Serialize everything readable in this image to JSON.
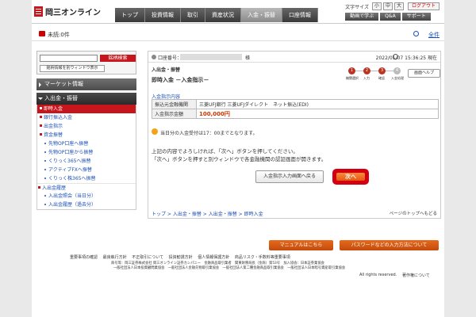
{
  "header": {
    "logo_text": "岡三オンライン",
    "nav": [
      "トップ",
      "投資情報",
      "取引",
      "資産状況",
      "入金・振替",
      "口座情報"
    ],
    "text_size_label": "文字サイズ",
    "text_sizes": [
      "小",
      "中",
      "大"
    ],
    "logout": "ログアウト",
    "util_buttons": [
      "動画で学ぶ",
      "Q&A",
      "サポート"
    ]
  },
  "unread": {
    "text": "未読:0件",
    "all": "全件"
  },
  "sidebar": {
    "search_button": "銘柄検索",
    "search_button2": "銘柄情報を別ウィンドウ表示",
    "market_info": "マーケット情報",
    "section": "入出金・振替",
    "items": [
      {
        "label": "即時入金",
        "kind": "sel"
      },
      {
        "label": "銀行振込入金",
        "kind": "item"
      },
      {
        "label": "出金指示",
        "kind": "item"
      },
      {
        "label": "資金振替",
        "kind": "item"
      },
      {
        "label": "先物OP口座へ振替",
        "kind": "sub"
      },
      {
        "label": "先物OP口座から振替",
        "kind": "sub"
      },
      {
        "label": "くりっく365へ振替",
        "kind": "sub"
      },
      {
        "label": "アクティブFXへ振替",
        "kind": "sub"
      },
      {
        "label": "くりっく株365へ振替",
        "kind": "sub"
      },
      {
        "label": "入出金履歴",
        "kind": "cat"
      },
      {
        "label": "入出金照会（当日分）",
        "kind": "sub"
      },
      {
        "label": "入出金履歴（過去分）",
        "kind": "sub"
      }
    ]
  },
  "main": {
    "account_label": "口座番号：",
    "account_suffix": "様",
    "datetime": "2022/01/07 15:36:25 現在",
    "crumb": "入出金・振替",
    "title": "即時入金 －入金指示－",
    "steps": [
      "1",
      "2",
      "3",
      "4"
    ],
    "step_labels": [
      "機関選択",
      "入力",
      "確認",
      "入金処理"
    ],
    "help": "画面ヘルプ",
    "section": "入金指示内容",
    "rows": [
      {
        "label": "振込元金融機関",
        "value": "三菱UFJ銀行 三菱UFJダイレクト　ネット振込(EDI)"
      },
      {
        "label": "入金指示金額",
        "value": "100,000円"
      }
    ],
    "note": "当日分の入金受付は17：00までとなります。",
    "msg1": "上記の内容でよろしければ、「次へ」ボタンを押してください。",
    "msg2": "「次へ」ボタンを押すと別ウィンドウで各金融機関の認証画面が開きます。",
    "back": "入金指示入力画面へ戻る",
    "next": "次へ",
    "breadcrumb": [
      "トップ",
      "入出金・振替",
      "入出金・振替",
      "即時入金"
    ],
    "page_top": "ページのトップへもどる"
  },
  "footer": {
    "manual": "マニュアルはこちら",
    "password": "パスワードなどの入力方法について",
    "links": [
      "重要事項の確認",
      "最良執行方針",
      "不正取引について",
      "投資勧誘方針",
      "個人情報保護方針",
      "商品リスク・手数料等重要事項"
    ],
    "legal1": "商号等：岡三証券株式会社 岡三オンライン証券カンパニー　金融商品取引業者　関東財務局長（金商）第53号　加入協会：日本証券業協会",
    "legal2": "一般社団法人日本投資顧問業協会　一般社団法人金融先物取引業協会　一般社団法人第二種金融商品取引業協会　一般社団法人日本暗号資産取引業協会",
    "copyright": "All rights reserved.",
    "policy": "著作権について"
  }
}
